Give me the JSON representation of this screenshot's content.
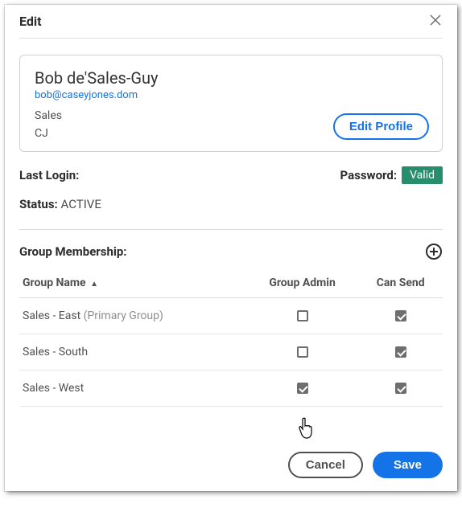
{
  "dialog": {
    "title": "Edit",
    "close_aria": "Close"
  },
  "profile": {
    "name": "Bob de'Sales-Guy",
    "email": "bob@caseyjones.dom",
    "title": "Sales",
    "initials": "CJ",
    "edit_btn": "Edit Profile"
  },
  "info": {
    "last_login_label": "Last Login:",
    "last_login_value": "",
    "password_label": "Password:",
    "password_badge": "Valid",
    "status_label": "Status:",
    "status_value": "ACTIVE"
  },
  "groups": {
    "section_title": "Group Membership:",
    "columns": {
      "name": "Group Name",
      "admin": "Group Admin",
      "can_send": "Can Send"
    },
    "rows": [
      {
        "name": "Sales - East",
        "primary": "(Primary Group)",
        "admin": false,
        "can_send": true
      },
      {
        "name": "Sales - South",
        "primary": "",
        "admin": false,
        "can_send": true
      },
      {
        "name": "Sales - West",
        "primary": "",
        "admin": true,
        "can_send": true
      }
    ]
  },
  "footer": {
    "cancel": "Cancel",
    "save": "Save"
  }
}
